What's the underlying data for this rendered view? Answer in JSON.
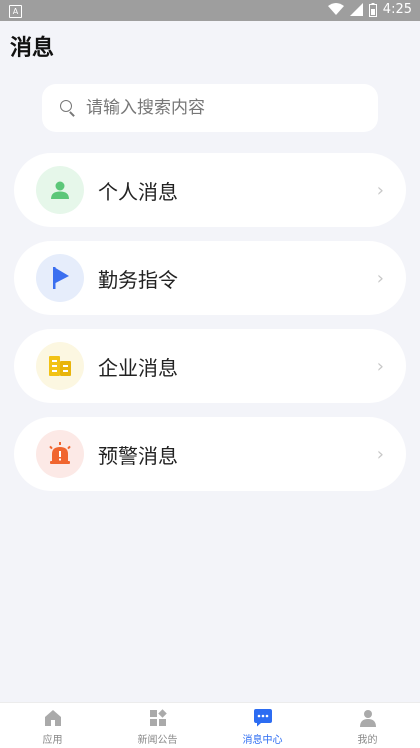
{
  "status": {
    "time": "4:25"
  },
  "page": {
    "title": "消息"
  },
  "search": {
    "placeholder": "请输入搜索内容"
  },
  "items": [
    {
      "label": "个人消息",
      "icon": "person-icon",
      "color": "#5cc779",
      "bg": "#e6f7ea"
    },
    {
      "label": "勤务指令",
      "icon": "flag-icon",
      "color": "#3b6ff0",
      "bg": "#e6edfb"
    },
    {
      "label": "企业消息",
      "icon": "building-icon",
      "color": "#f2c215",
      "bg": "#fcf7e1"
    },
    {
      "label": "预警消息",
      "icon": "alarm-icon",
      "color": "#f0652f",
      "bg": "#fce9e6"
    }
  ],
  "tabs": [
    {
      "label": "应用",
      "icon": "home-icon",
      "active": false
    },
    {
      "label": "新闻公告",
      "icon": "grid-icon",
      "active": false
    },
    {
      "label": "消息中心",
      "icon": "chat-icon",
      "active": true
    },
    {
      "label": "我的",
      "icon": "user-icon",
      "active": false
    }
  ],
  "colors": {
    "accent": "#2c6cf2",
    "background": "#f3f4f9"
  }
}
